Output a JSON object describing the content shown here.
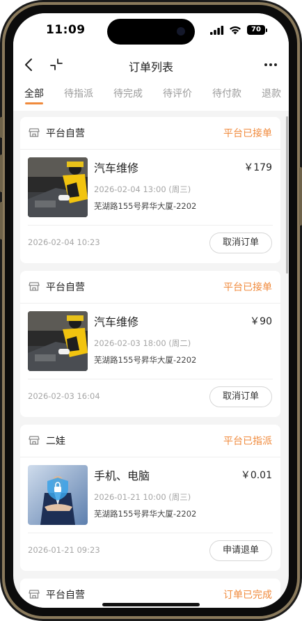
{
  "status_bar": {
    "time": "11:09",
    "battery": "70"
  },
  "navbar": {
    "title": "订单列表"
  },
  "tabs": [
    "全部",
    "待指派",
    "待完成",
    "待评价",
    "待付款",
    "退款"
  ],
  "accent_color": "#f08a3c",
  "orders": [
    {
      "store": "平台自营",
      "status": "平台已接单",
      "service": "汽车维修",
      "price": "￥179",
      "appointment": "2026-02-04 13:00 (周三)",
      "address": "芜湖路155号昇华大厦-2202",
      "created": "2026-02-04 10:23",
      "action": "取消订单",
      "image": "car-repair-photo"
    },
    {
      "store": "平台自营",
      "status": "平台已接单",
      "service": "汽车维修",
      "price": "￥90",
      "appointment": "2026-02-03 18:00 (周二)",
      "address": "芜湖路155号昇华大厦-2202",
      "created": "2026-02-03 16:04",
      "action": "取消订单",
      "image": "car-repair-photo"
    },
    {
      "store": "二娃",
      "status": "平台已指派",
      "service": "手机、电脑",
      "price": "￥0.01",
      "appointment": "2026-01-21 10:00 (周三)",
      "address": "芜湖路155号昇华大厦-2202",
      "created": "2026-01-21 09:23",
      "action": "申请退单",
      "image": "security-shield-photo"
    },
    {
      "store": "平台自营",
      "status": "订单已完成"
    }
  ]
}
